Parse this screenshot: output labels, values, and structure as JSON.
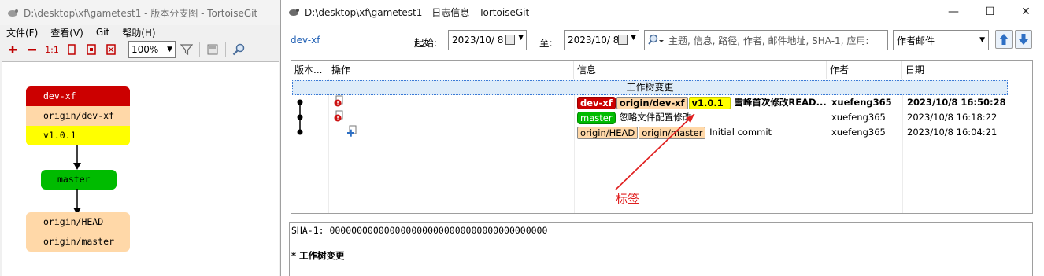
{
  "graph_window": {
    "title": "D:\\desktop\\xf\\gametest1 - 版本分支图 - TortoiseGit",
    "menu": [
      "文件(F)",
      "查看(V)",
      "Git",
      "帮助(H)"
    ],
    "toolbar": {
      "zoom_value": "100%",
      "one_to_one_label": "1:1"
    },
    "nodes": [
      {
        "rows": [
          {
            "label": "dev-xf",
            "color": "#cc0000"
          },
          {
            "label": "origin/dev-xf",
            "color": "#ffd8a8"
          },
          {
            "label": "v1.0.1",
            "color": "#ffff00"
          }
        ]
      },
      {
        "rows": [
          {
            "label": "master",
            "color": "#00bb00"
          }
        ]
      },
      {
        "rows": [
          {
            "label": "origin/HEAD",
            "color": "#ffd8a8"
          },
          {
            "label": "origin/master",
            "color": "#ffd8a8"
          }
        ]
      }
    ]
  },
  "log_window": {
    "title": "D:\\desktop\\xf\\gametest1 - 日志信息 - TortoiseGit",
    "controls": {
      "minimize": "—",
      "maximize": "☐",
      "close": "✕"
    },
    "branch": "dev-xf",
    "from_label": "起始:",
    "from_date": "2023/10/  8",
    "to_label": "至:",
    "to_date": "2023/10/  8",
    "search_placeholder": "主题, 信息, 路径, 作者, 邮件地址, SHA-1, 应用:",
    "filter_select": "作者邮件",
    "columns": [
      "版本...",
      "操作",
      "信息",
      "作者",
      "日期"
    ],
    "working_tree_row": "工作树变更",
    "rows": [
      {
        "tags": [
          "dev-xf",
          "origin/dev-xf",
          "v1.0.1"
        ],
        "message": "雪峰首次修改READ...",
        "author": "xuefeng365",
        "date": "2023/10/8 16:50:28"
      },
      {
        "tags": [
          "master"
        ],
        "message": "忽略文件配置修改",
        "author": "xuefeng365",
        "date": "2023/10/8 16:18:22"
      },
      {
        "tags": [
          "origin/HEAD",
          "origin/master"
        ],
        "message": "Initial commit",
        "author": "xuefeng365",
        "date": "2023/10/8 16:04:21"
      }
    ],
    "annotation_label": "标签",
    "detail": {
      "sha_line": "SHA-1: 0000000000000000000000000000000000000000",
      "summary_line": "* 工作树变更"
    },
    "colors": {
      "tag_red": "#cc0000",
      "tag_peach": "#ffd8a8",
      "tag_yellow": "#ffff00",
      "tag_green": "#00bb00",
      "annotation": "#e02020",
      "link": "#1f5fb4"
    }
  }
}
